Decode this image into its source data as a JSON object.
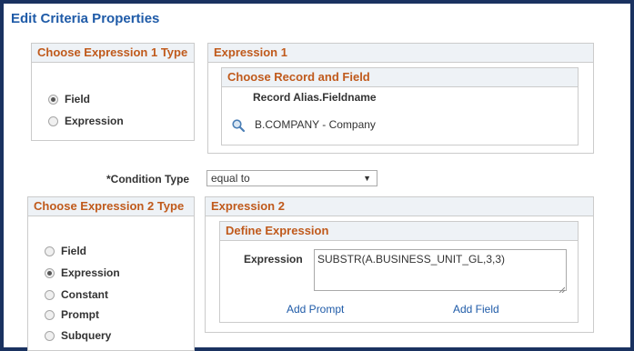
{
  "page": {
    "title": "Edit Criteria Properties"
  },
  "expr1_type": {
    "header": "Choose Expression 1 Type",
    "options": [
      {
        "label": "Field",
        "checked": true
      },
      {
        "label": "Expression",
        "checked": false
      }
    ]
  },
  "expr1": {
    "header": "Expression 1",
    "subheader": "Choose Record and Field",
    "column_label": "Record Alias.Fieldname",
    "value": "B.COMPANY - Company",
    "lookup_icon": "magnifier-icon"
  },
  "condition": {
    "label": "*Condition Type",
    "selected": "equal to"
  },
  "expr2_type": {
    "header": "Choose Expression 2 Type",
    "options": [
      {
        "label": "Field",
        "checked": false
      },
      {
        "label": "Expression",
        "checked": true
      },
      {
        "label": "Constant",
        "checked": false
      },
      {
        "label": "Prompt",
        "checked": false
      },
      {
        "label": "Subquery",
        "checked": false
      }
    ]
  },
  "expr2": {
    "header": "Expression 2",
    "subheader": "Define Expression",
    "field_label": "Expression",
    "value": "SUBSTR(A.BUSINESS_UNIT_GL,3,3)",
    "add_prompt": "Add Prompt",
    "add_field": "Add Field"
  },
  "colors": {
    "title": "#1f5ba8",
    "header_text": "#c05a1c",
    "header_bg": "#eef2f6",
    "frame": "#1a3260",
    "link": "#1f5ba8"
  }
}
